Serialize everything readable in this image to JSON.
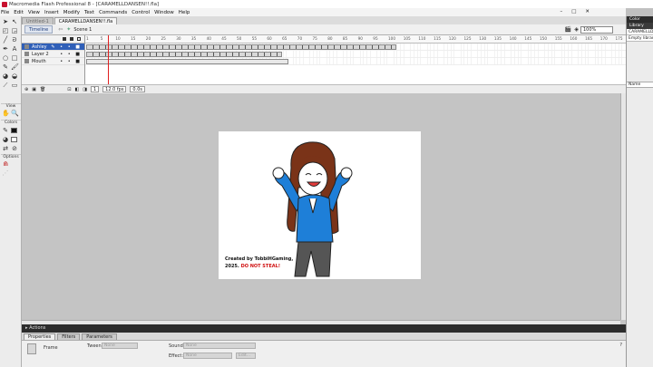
{
  "window": {
    "title": "Macromedia Flash Professional 8 - [CARAMELLDANSEN!!.fla]",
    "controls": [
      "–",
      "□",
      "✕"
    ]
  },
  "menu": [
    "File",
    "Edit",
    "View",
    "Insert",
    "Modify",
    "Text",
    "Commands",
    "Control",
    "Window",
    "Help"
  ],
  "tools": {
    "view_label": "View",
    "colors_label": "Colors",
    "options_label": "Options"
  },
  "document": {
    "tabs": [
      "Untitled-1",
      "CARAMELLDANSEN!!.fla"
    ],
    "timeline_button": "Timeline",
    "scene": "Scene 1",
    "zoom": "100%"
  },
  "timeline": {
    "layers": [
      {
        "name": "Ashley",
        "selected": true
      },
      {
        "name": "Layer 2",
        "selected": false
      },
      {
        "name": "Mouth",
        "selected": false
      }
    ],
    "ruler_ticks": [
      "1",
      "5",
      "10",
      "15",
      "20",
      "25",
      "30",
      "35",
      "40",
      "45",
      "50",
      "55",
      "60",
      "65",
      "70",
      "75",
      "80",
      "85",
      "90",
      "95",
      "100",
      "105",
      "110",
      "115",
      "120",
      "125",
      "130",
      "135",
      "140",
      "145",
      "150",
      "155",
      "160",
      "165",
      "170",
      "175"
    ],
    "current_frame": "1",
    "fps": "12.0 fps",
    "elapsed": "0.0s"
  },
  "stage": {
    "credit_line1": "Created by TobbiHGaming,",
    "credit_year": "2025.",
    "credit_warning": "DO NOT STEAL!"
  },
  "panels": {
    "actions": "Actions",
    "properties_tabs": [
      "Properties",
      "Filters",
      "Parameters"
    ],
    "properties": {
      "frame_label": "Frame",
      "tween_label": "Tween:",
      "tween_value": "None",
      "sound_label": "Sound:",
      "sound_value": "None",
      "effect_label": "Effect:",
      "effect_value": "None",
      "edit_button": "Edit..."
    }
  },
  "right_panel": {
    "color_tab": "Color",
    "library_tab": "Library",
    "library_doc": "CARAMELLDANSEN!!.fla",
    "empty_library": "Empty library",
    "name_header": "Name"
  }
}
